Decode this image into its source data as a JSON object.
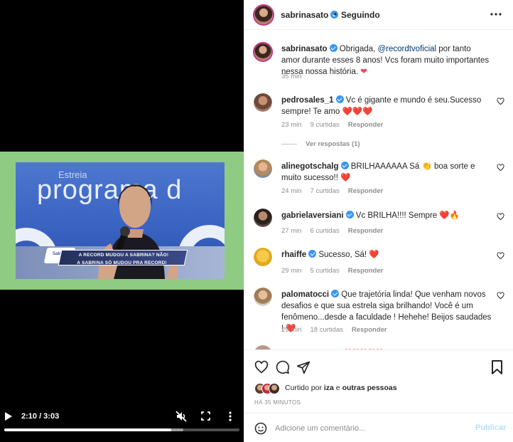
{
  "video": {
    "time": "2:10 / 3:03",
    "progress_fraction": 0.71,
    "buffered_fraction": 0.76,
    "screen_text": {
      "estreia": "Estreia",
      "programa": "programa d",
      "lower_third_line1": "A RECORD MUDOU A SABRINA? NÃO!",
      "lower_third_line2": "A SABRINA SÓ MUDOU PRA RECORD!",
      "logo": "Sabrina"
    }
  },
  "post": {
    "author": "sabrinasato",
    "dot": "•",
    "following_label": "Seguindo",
    "caption": {
      "user": "sabrinasato",
      "text_before": " Obrigada, ",
      "mention": "@recordtvoficial",
      "text_after": " por tanto amor durante esses 8 anos! Vcs foram muito importantes nessa nossa história. ",
      "time": "35 min"
    },
    "comments": [
      {
        "user": "pedrosales_1",
        "text": " Vc é gigante e mundo é seu.Sucesso sempre! Te amo ",
        "hearts": "❤️❤️❤️",
        "time": "23 min",
        "likes": "9 curtidas",
        "reply": "Responder",
        "view_replies": "Ver respostas (1)"
      },
      {
        "user": "alinegotschalg",
        "text": " BRILHAAAAAA Sá 👏 boa sorte e muito sucesso!! ",
        "hearts": "❤️",
        "time": "24 min",
        "likes": "7 curtidas",
        "reply": "Responder"
      },
      {
        "user": "gabrielaversiani",
        "text": " Vc BRILHA!!!! Sempre ",
        "hearts": "❤️🔥",
        "time": "27 min",
        "likes": "6 curtidas",
        "reply": "Responder"
      },
      {
        "user": "rhaiffe",
        "text": " Sucesso, Sá! ",
        "hearts": "❤️",
        "time": "29 min",
        "likes": "5 curtidas",
        "reply": "Responder"
      },
      {
        "user": "palomatocci",
        "text": " Que trajetória linda! Que venham novos desafios e que sua estrela siga brilhando! Você é um fenômeno...desde a faculdade ! Hehehe! Beijos saudades ! ",
        "hearts": "❤️",
        "time": "29 min",
        "likes": "18 curtidas",
        "reply": "Responder"
      }
    ],
    "partial_comment": "❤️❤️❤️❤️❤️"
  },
  "actions": {
    "liked_prefix": "Curtido por ",
    "liked_user": "iza",
    "liked_middle": " e ",
    "liked_others": "outras pessoas",
    "post_age": "HÁ 35 MINUTOS",
    "comment_placeholder": "Adicione um comentário...",
    "publish_label": "Publicar"
  },
  "colors": {
    "verified": "#3897f0",
    "heart": "#ed4956",
    "link": "#00376b",
    "muted": "#8e8e8e",
    "publish_disabled": "#b2dffc"
  }
}
